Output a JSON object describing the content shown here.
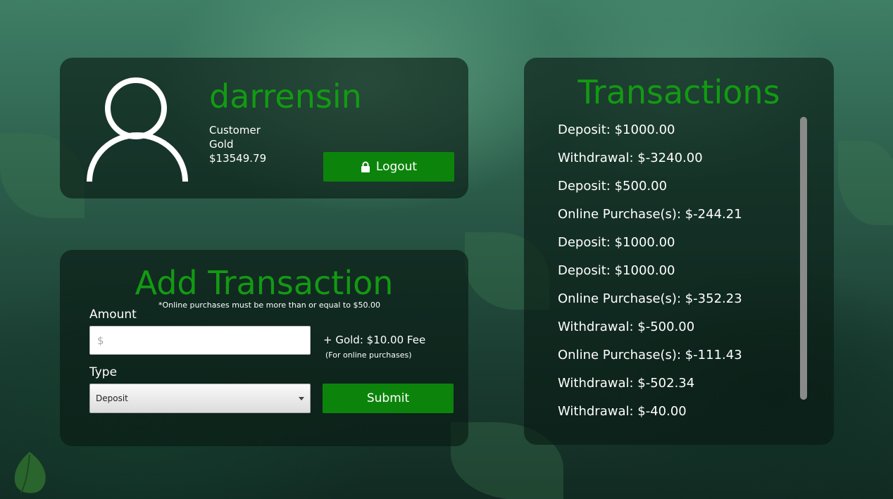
{
  "profile": {
    "username": "darrensin",
    "role": "Customer",
    "tier": "Gold",
    "balance": "$13549.79",
    "logout_label": "Logout"
  },
  "add_transaction": {
    "title": "Add Transaction",
    "note": "*Online purchases must be more than or equal to $50.00",
    "amount_label": "Amount",
    "amount_placeholder": "$",
    "fee_text": "+ Gold: $10.00 Fee",
    "fee_subtext": "(For online purchases)",
    "type_label": "Type",
    "type_selected": "Deposit",
    "submit_label": "Submit"
  },
  "history": {
    "title": "Transactions",
    "items": [
      "Deposit: $1000.00",
      "Withdrawal: $-3240.00",
      "Deposit: $500.00",
      "Online Purchase(s): $-244.21",
      "Deposit: $1000.00",
      "Deposit: $1000.00",
      "Online Purchase(s): $-352.23",
      "Withdrawal: $-500.00",
      "Online Purchase(s): $-111.43",
      "Withdrawal: $-502.34",
      "Withdrawal: $-40.00"
    ]
  },
  "colors": {
    "accent_green": "#139a13",
    "button_green": "#0c840c"
  },
  "icons": {
    "avatar": "user-outline-icon",
    "logout": "lock-icon",
    "select": "chevron-down-icon",
    "corner": "leaf-icon"
  }
}
